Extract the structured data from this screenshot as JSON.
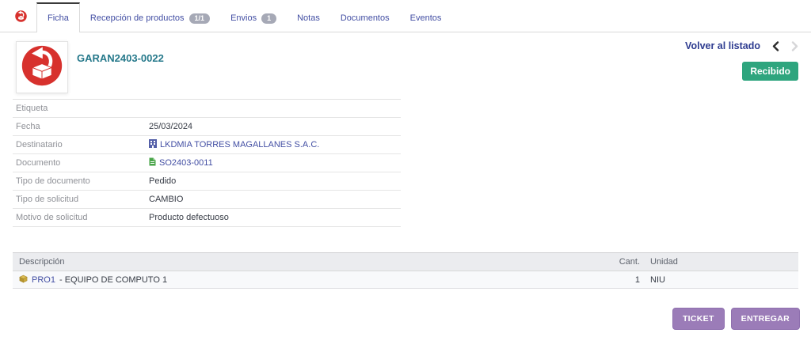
{
  "tabs": {
    "items": [
      {
        "label": "Ficha"
      },
      {
        "label": "Recepción de productos",
        "badge": "1/1"
      },
      {
        "label": "Envios",
        "badge": "1"
      },
      {
        "label": "Notas"
      },
      {
        "label": "Documentos"
      },
      {
        "label": "Eventos"
      }
    ]
  },
  "header": {
    "reference": "GARAN2403-0022",
    "back_link": "Volver al listado",
    "status": "Recibido"
  },
  "fields": [
    {
      "label": "Etiqueta",
      "value": ""
    },
    {
      "label": "Fecha",
      "value": "25/03/2024"
    },
    {
      "label": "Destinatario",
      "value": "LKDMIA TORRES MAGALLANES S.A.C."
    },
    {
      "label": "Documento",
      "value": "SO2403-0011"
    },
    {
      "label": "Tipo de documento",
      "value": "Pedido"
    },
    {
      "label": "Tipo de solicitud",
      "value": "CAMBIO"
    },
    {
      "label": "Motivo de solicitud",
      "value": "Producto defectuoso"
    }
  ],
  "table": {
    "headers": {
      "description": "Descripción",
      "qty": "Cant.",
      "unit": "Unidad"
    },
    "rows": [
      {
        "code": "PRO1",
        "description": " - EQUIPO DE COMPUTO 1",
        "qty": "1",
        "unit": "NIU"
      }
    ]
  },
  "actions": {
    "ticket": "TICKET",
    "deliver": "ENTREGAR"
  },
  "colors": {
    "brand_red": "#d7312d",
    "link_indigo": "#424ea3",
    "title_teal": "#26798b",
    "status_green": "#2ea57e",
    "button_purple": "#9b7cb8",
    "badge_gray": "#a6a9b6"
  },
  "icons": {
    "module_logo": "package-return-icon",
    "recipient": "building-icon",
    "document": "file-icon",
    "product": "cube-icon",
    "nav_prev": "chevron-left-icon",
    "nav_next": "chevron-right-icon"
  }
}
